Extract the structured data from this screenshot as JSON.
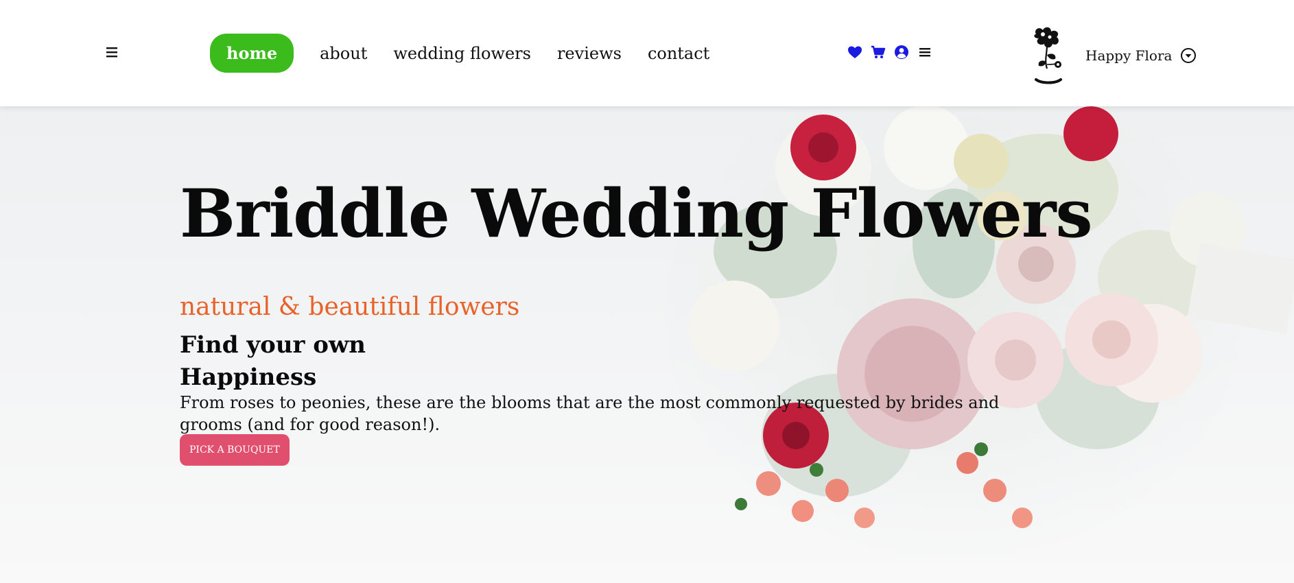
{
  "header": {
    "menu_icon": "hamburger-menu-icon",
    "nav": [
      {
        "label": "home",
        "active": true
      },
      {
        "label": "about",
        "active": false
      },
      {
        "label": "wedding flowers",
        "active": false
      },
      {
        "label": "reviews",
        "active": false
      },
      {
        "label": "contact",
        "active": false
      }
    ],
    "icons": [
      "heart-icon",
      "cart-icon",
      "user-circle-icon",
      "menu-icon"
    ],
    "brand": {
      "logo": "flower-vase-logo",
      "name": "Happy Flora",
      "dropdown_icon": "chevron-down-circle-icon"
    }
  },
  "hero": {
    "title": "Briddle Wedding Flowers",
    "tagline": "natural & beautiful flowers",
    "subtitle_line1": "Find your own",
    "subtitle_line2": "Happiness",
    "description": "From roses to peonies, these are the blooms that are the most commonly requested by brides and grooms (and for good reason!).",
    "cta_label": "PICK A BOUQUET",
    "background": "wedding-bouquet-photo"
  },
  "colors": {
    "active_nav": "#3cbb1c",
    "tagline": "#e8622a",
    "cta": "#e0506e",
    "icons": "#1a1ae0"
  }
}
